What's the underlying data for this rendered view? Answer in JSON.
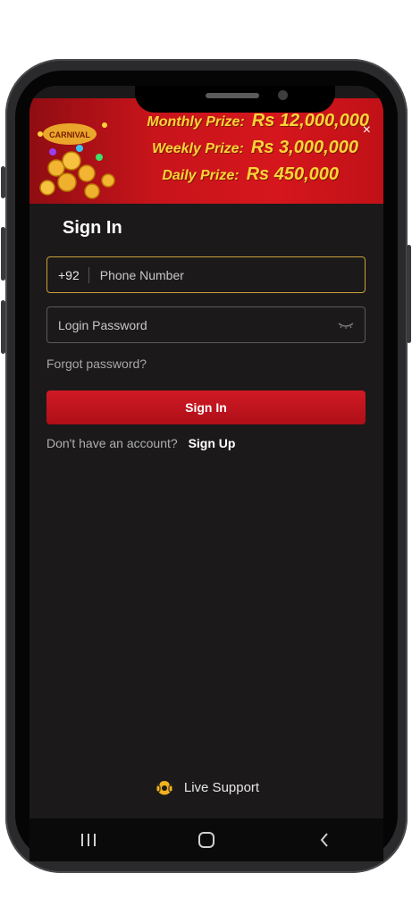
{
  "banner": {
    "prizes": [
      {
        "label": "Monthly Prize:",
        "amount": "Rs 12,000,000"
      },
      {
        "label": "Weekly Prize:",
        "amount": "Rs 3,000,000"
      },
      {
        "label": "Daily Prize:",
        "amount": "Rs 450,000"
      }
    ],
    "close_label": "×",
    "art_text": "CARNIVAL"
  },
  "signin": {
    "title": "Sign In",
    "country_code": "+92",
    "phone_placeholder": "Phone Number",
    "password_placeholder": "Login Password",
    "forgot_label": "Forgot password?",
    "button_label": "Sign In",
    "no_account_text": "Don't have an account?",
    "signup_label": "Sign Up"
  },
  "support": {
    "label": "Live Support"
  },
  "colors": {
    "accent": "#c8141b",
    "prize_text": "#ffd23a",
    "focus_border": "#c9a13a",
    "background": "#1b191a"
  },
  "icons": [
    "eye-closed-icon",
    "headset-icon",
    "recent-apps-icon",
    "home-icon",
    "back-icon"
  ]
}
